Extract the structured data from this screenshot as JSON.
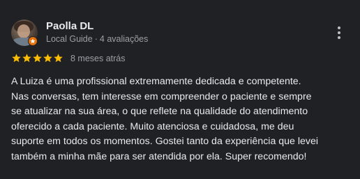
{
  "reviewer": {
    "name": "Paolla DL",
    "badge": "Local Guide",
    "separator": "·",
    "review_count": "4 avaliações"
  },
  "rating": {
    "stars": 5,
    "max_stars": 5,
    "star_color": "#fbbc04"
  },
  "review": {
    "date": "8 meses atrás",
    "lines": [
      "A Luiza é uma profissional extremamente dedicada e competente.",
      "Nas conversas, tem interesse em compreender o paciente e sempre",
      "se atualizar na sua área, o que reflete na qualidade do atendimento",
      "oferecido a cada paciente. Muito atenciosa e cuidadosa, me deu",
      "suporte em todos os momentos. Gostei tanto da experiência que levei",
      "também a minha mãe para ser atendida por ela. Super recomendo!"
    ]
  },
  "icons": {
    "menu": "more-vert-icon",
    "badge": "local-guide-badge-icon",
    "star": "star-icon"
  },
  "colors": {
    "background": "#202124",
    "text_primary": "#e8eaed",
    "text_secondary": "#9aa0a6",
    "local_guide_badge": "#e8710a"
  }
}
